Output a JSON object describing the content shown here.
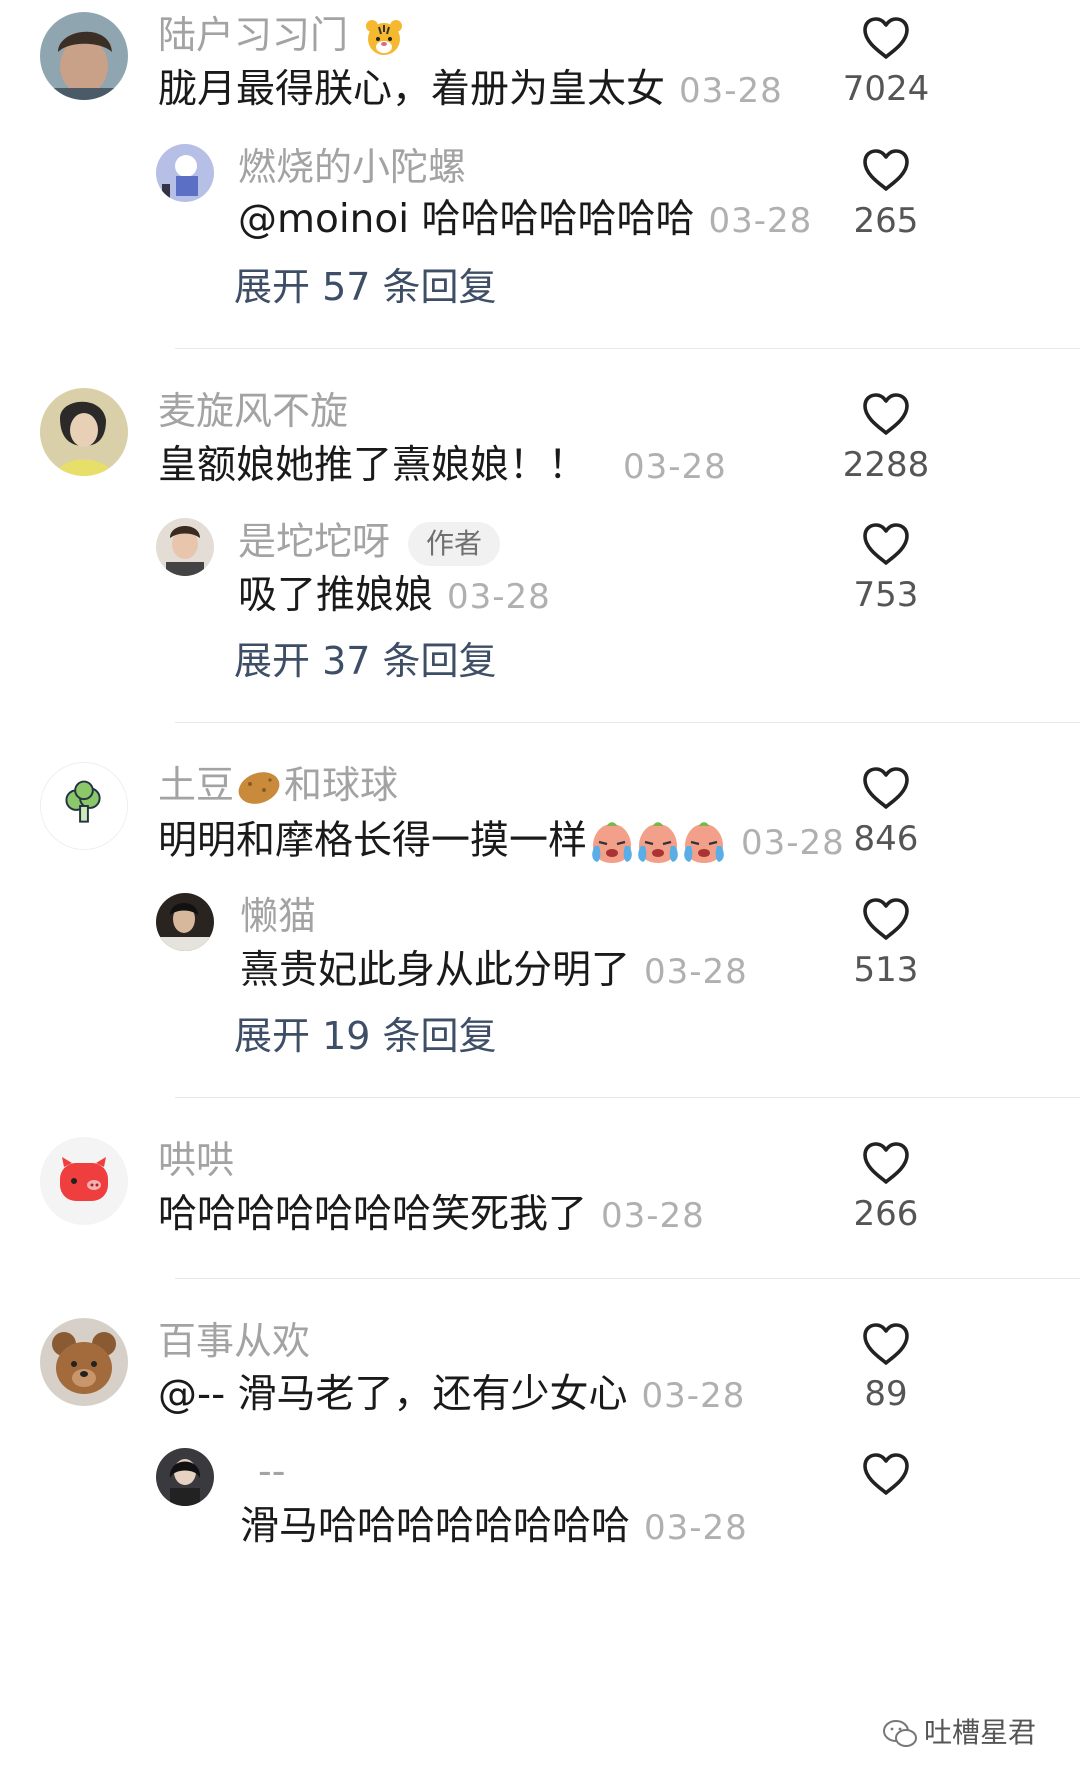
{
  "comments": [
    {
      "username": "陆户习习门",
      "text": "胧月最得朕心，着册为皇太女",
      "date": "03-28",
      "likes": "7024",
      "reply": {
        "username": "燃烧的小陀螺",
        "text": "@moinoi 哈哈哈哈哈哈哈",
        "date": "03-28",
        "likes": "265"
      },
      "expand_label": "展开 57 条回复"
    },
    {
      "username": "麦旋风不旋",
      "text": "皇额娘她推了熹娘娘！！",
      "date": "03-28",
      "likes": "2288",
      "reply": {
        "username": "是坨坨呀",
        "badge": "作者",
        "text": "吸了推娘娘",
        "date": "03-28",
        "likes": "753"
      },
      "expand_label": "展开 37 条回复"
    },
    {
      "username_part1": "土豆",
      "username_part2": "和球球",
      "text": "明明和摩格长得一摸一样",
      "date": "03-28",
      "likes": "846",
      "reply": {
        "username": "懒猫",
        "text": "熹贵妃此身从此分明了",
        "date": "03-28",
        "likes": "513"
      },
      "expand_label": "展开 19 条回复"
    },
    {
      "username": "哄哄",
      "text": "哈哈哈哈哈哈哈笑死我了",
      "date": "03-28",
      "likes": "266"
    },
    {
      "username": "百事从欢",
      "text": "@-- 滑马老了，还有少女心",
      "date": "03-28",
      "likes": "89",
      "reply": {
        "username": "--",
        "text": "滑马哈哈哈哈哈哈哈哈",
        "date": "03-28"
      }
    }
  ],
  "watermark": "吐槽星君",
  "colors": {
    "username": "#a3a3a3",
    "text": "#1a1a1a",
    "expand": "#3d4e66",
    "divider": "#e8e8e8"
  }
}
